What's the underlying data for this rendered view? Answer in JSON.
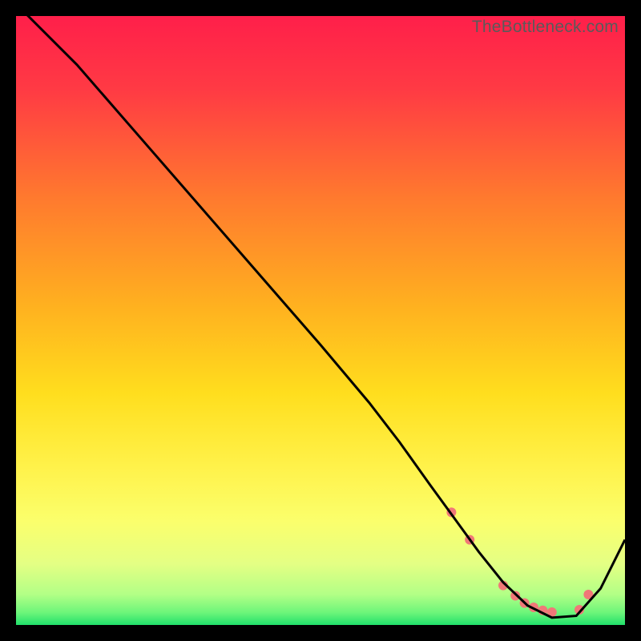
{
  "watermark": "TheBottleneck.com",
  "chart_data": {
    "type": "line",
    "title": "",
    "xlabel": "",
    "ylabel": "",
    "xlim": [
      0,
      100
    ],
    "ylim": [
      0,
      100
    ],
    "grid": false,
    "legend": false,
    "background_gradient": {
      "top_color": "#ff1f4a",
      "mid_colors": [
        "#ff8a2a",
        "#ffd91f",
        "#fff85a"
      ],
      "bottom_color": "#21e06b"
    },
    "series": [
      {
        "name": "bottleneck-curve",
        "color": "#000000",
        "x": [
          0,
          4,
          10,
          20,
          30,
          40,
          50,
          58,
          63,
          68,
          72,
          76,
          80,
          84,
          88,
          92,
          96,
          100
        ],
        "y": [
          102,
          98,
          92,
          80.5,
          69,
          57.5,
          46,
          36.5,
          30,
          23,
          17.5,
          12,
          7,
          3.2,
          1.2,
          1.5,
          6,
          14
        ]
      }
    ],
    "markers": {
      "name": "highlight-points",
      "color": "#f07878",
      "radius": 6,
      "x": [
        71.5,
        74.5,
        80,
        82,
        83.5,
        85,
        86.5,
        88,
        92.5,
        94
      ],
      "y": [
        18.5,
        14,
        6.5,
        4.8,
        3.6,
        2.9,
        2.4,
        2.1,
        2.5,
        5.0
      ]
    }
  }
}
